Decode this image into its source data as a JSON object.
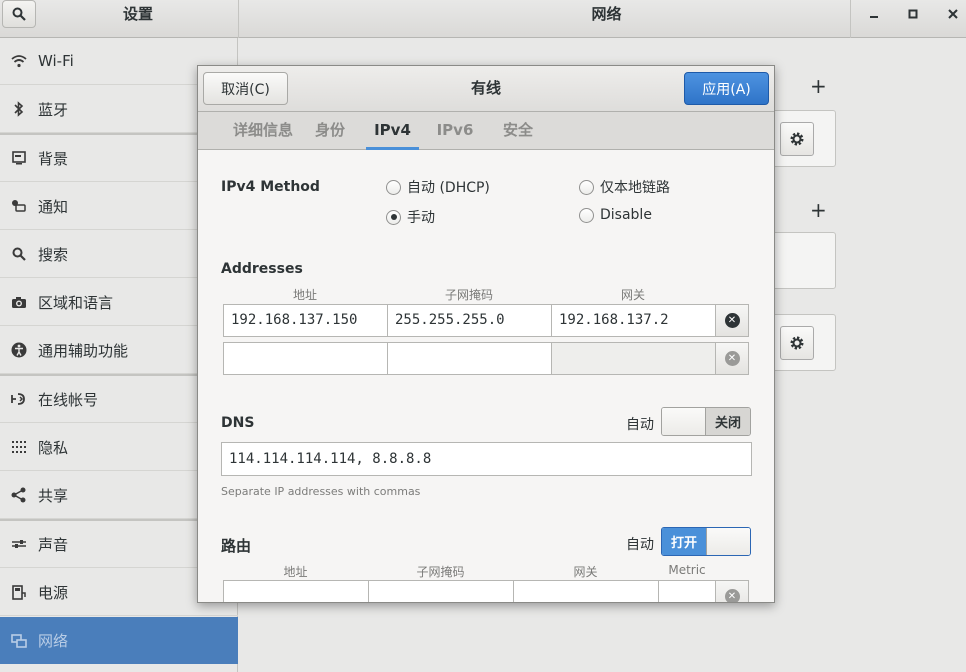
{
  "headerbar": {
    "left_title": "设置",
    "right_title": "网络",
    "minimize": "–",
    "maximize": "□",
    "close": "×"
  },
  "sidebar": {
    "items": [
      {
        "label": "Wi-Fi",
        "icon": "wifi-icon"
      },
      {
        "label": "蓝牙",
        "icon": "bluetooth-icon"
      },
      {
        "label": "背景",
        "icon": "background-icon"
      },
      {
        "label": "通知",
        "icon": "notification-icon"
      },
      {
        "label": "搜索",
        "icon": "search-icon"
      },
      {
        "label": "区域和语言",
        "icon": "camera-icon"
      },
      {
        "label": "通用辅助功能",
        "icon": "accessibility-icon"
      },
      {
        "label": "在线帐号",
        "icon": "online-accounts-icon"
      },
      {
        "label": "隐私",
        "icon": "privacy-icon"
      },
      {
        "label": "共享",
        "icon": "share-icon"
      },
      {
        "label": "声音",
        "icon": "sound-icon"
      },
      {
        "label": "电源",
        "icon": "power-icon"
      },
      {
        "label": "网络",
        "icon": "network-icon",
        "active": true
      }
    ]
  },
  "dialog": {
    "title": "有线",
    "cancel": "取消(C)",
    "apply": "应用(A)",
    "tabs": [
      "详细信息",
      "身份",
      "IPv4",
      "IPv6",
      "安全"
    ],
    "active_tab": "IPv4",
    "ipv4_method_label": "IPv4 Method",
    "methods": [
      {
        "label": "自动 (DHCP)",
        "selected": false
      },
      {
        "label": "仅本地链路",
        "selected": false
      },
      {
        "label": "手动",
        "selected": true
      },
      {
        "label": "Disable",
        "selected": false
      }
    ],
    "addresses": {
      "title": "Addresses",
      "headers": [
        "地址",
        "子网掩码",
        "网关"
      ],
      "rows": [
        [
          "192.168.137.150",
          "255.255.255.0",
          "192.168.137.2"
        ],
        [
          "",
          "",
          ""
        ]
      ]
    },
    "dns": {
      "title": "DNS",
      "auto_label": "自动",
      "switch_label": "关闭",
      "value": "114.114.114.114, 8.8.8.8",
      "hint": "Separate IP addresses with commas"
    },
    "routes": {
      "title": "路由",
      "auto_label": "自动",
      "switch_label": "打开",
      "headers": [
        "地址",
        "子网掩码",
        "网关",
        "Metric"
      ]
    }
  },
  "colors": {
    "accent": "#4a90d9",
    "sidebar_active": "#4a7ebb",
    "apply_button": "#3a80d2"
  }
}
